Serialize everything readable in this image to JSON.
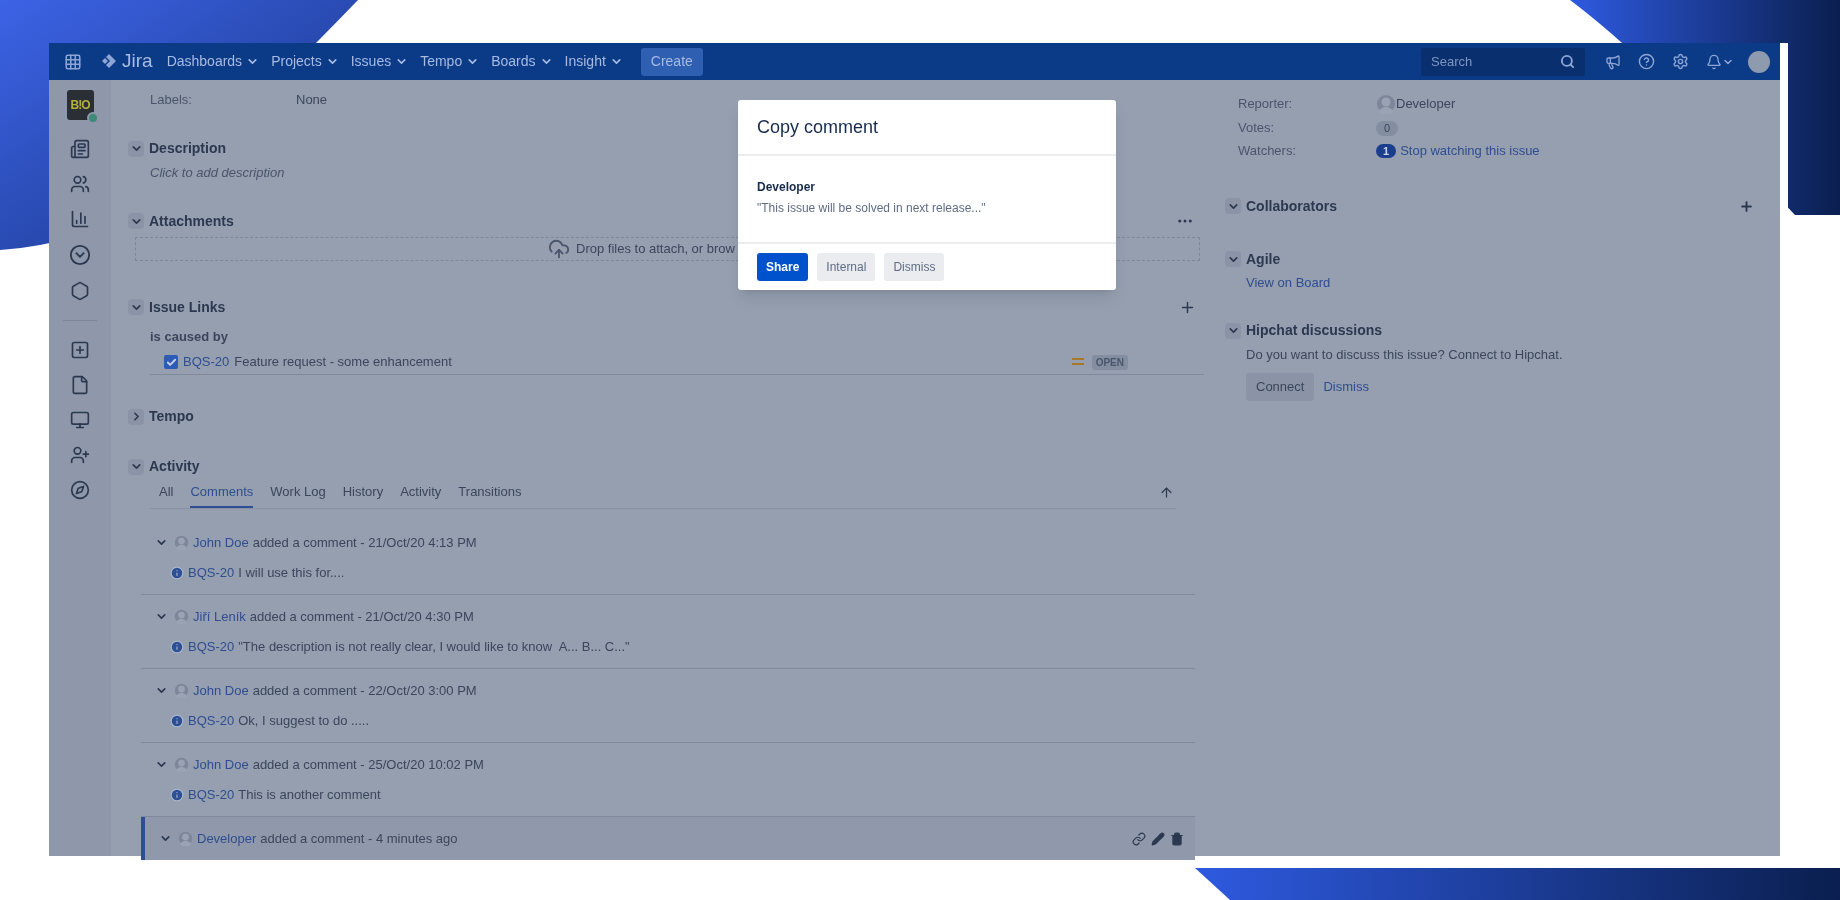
{
  "nav": {
    "logo": "Jira",
    "items": [
      {
        "label": "Dashboards"
      },
      {
        "label": "Projects"
      },
      {
        "label": "Issues"
      },
      {
        "label": "Tempo"
      },
      {
        "label": "Boards"
      },
      {
        "label": "Insight"
      }
    ],
    "create": "Create",
    "search": {
      "placeholder": "Search"
    }
  },
  "project_avatar": {
    "text": "B!O"
  },
  "labels": {
    "label": "Labels:",
    "value": "None"
  },
  "description": {
    "title": "Description",
    "expanded": true,
    "placeholder": "Click to add description"
  },
  "attachments": {
    "title": "Attachments",
    "expanded": true,
    "drop_text": "Drop files to attach, or brow"
  },
  "issue_links": {
    "title": "Issue Links",
    "expanded": true,
    "relation": "is caused by",
    "links": [
      {
        "key": "BQS-20",
        "summary": "Feature request - some enhancement",
        "status": "OPEN",
        "checked": true
      }
    ]
  },
  "tempo": {
    "title": "Tempo",
    "expanded": false
  },
  "activity": {
    "title": "Activity",
    "expanded": true,
    "tabs": [
      {
        "label": "All",
        "selected": false
      },
      {
        "label": "Comments",
        "selected": true
      },
      {
        "label": "Work Log",
        "selected": false
      },
      {
        "label": "History",
        "selected": false
      },
      {
        "label": "Activity",
        "selected": false
      },
      {
        "label": "Transitions",
        "selected": false
      }
    ],
    "comments": [
      {
        "author": "John Doe",
        "action": "added a comment - 21/Oct/20 4:13 PM",
        "key": "BQS-20",
        "body": "I will use this for....",
        "selected": false
      },
      {
        "author": "Jiří Leník",
        "action": "added a comment - 21/Oct/20 4:30 PM",
        "key": "BQS-20",
        "body": "\"The description is not really clear, I would like to know  A... B... C...\"",
        "selected": false
      },
      {
        "author": "John Doe",
        "action": "added a comment - 22/Oct/20 3:00 PM",
        "key": "BQS-20",
        "body": "Ok, I suggest to do .....",
        "selected": false
      },
      {
        "author": "John Doe",
        "action": "added a comment - 25/Oct/20 10:02 PM",
        "key": "BQS-20",
        "body": "This is another comment",
        "selected": false
      },
      {
        "author": "Developer",
        "action": "added a comment - 4 minutes ago",
        "selected": true
      }
    ]
  },
  "people": {
    "reporter": {
      "label": "Reporter:",
      "value": "Developer"
    },
    "votes": {
      "label": "Votes:",
      "count": "0"
    },
    "watchers": {
      "label": "Watchers:",
      "count": "1",
      "link": "Stop watching this issue"
    }
  },
  "collaborators": {
    "title": "Collaborators",
    "expanded": true
  },
  "agile": {
    "title": "Agile",
    "expanded": true,
    "link": "View on Board"
  },
  "hipchat": {
    "title": "Hipchat discussions",
    "expanded": true,
    "text": "Do you want to discuss this issue? Connect to Hipchat.",
    "connect": "Connect",
    "dismiss": "Dismiss"
  },
  "dialog": {
    "title": "Copy comment",
    "author": "Developer",
    "quote": "\"This issue will be solved in next release...\"",
    "buttons": [
      {
        "label": "Share",
        "kind": "primary"
      },
      {
        "label": "Internal",
        "kind": "subtle"
      },
      {
        "label": "Dismiss",
        "kind": "subtle"
      }
    ]
  }
}
